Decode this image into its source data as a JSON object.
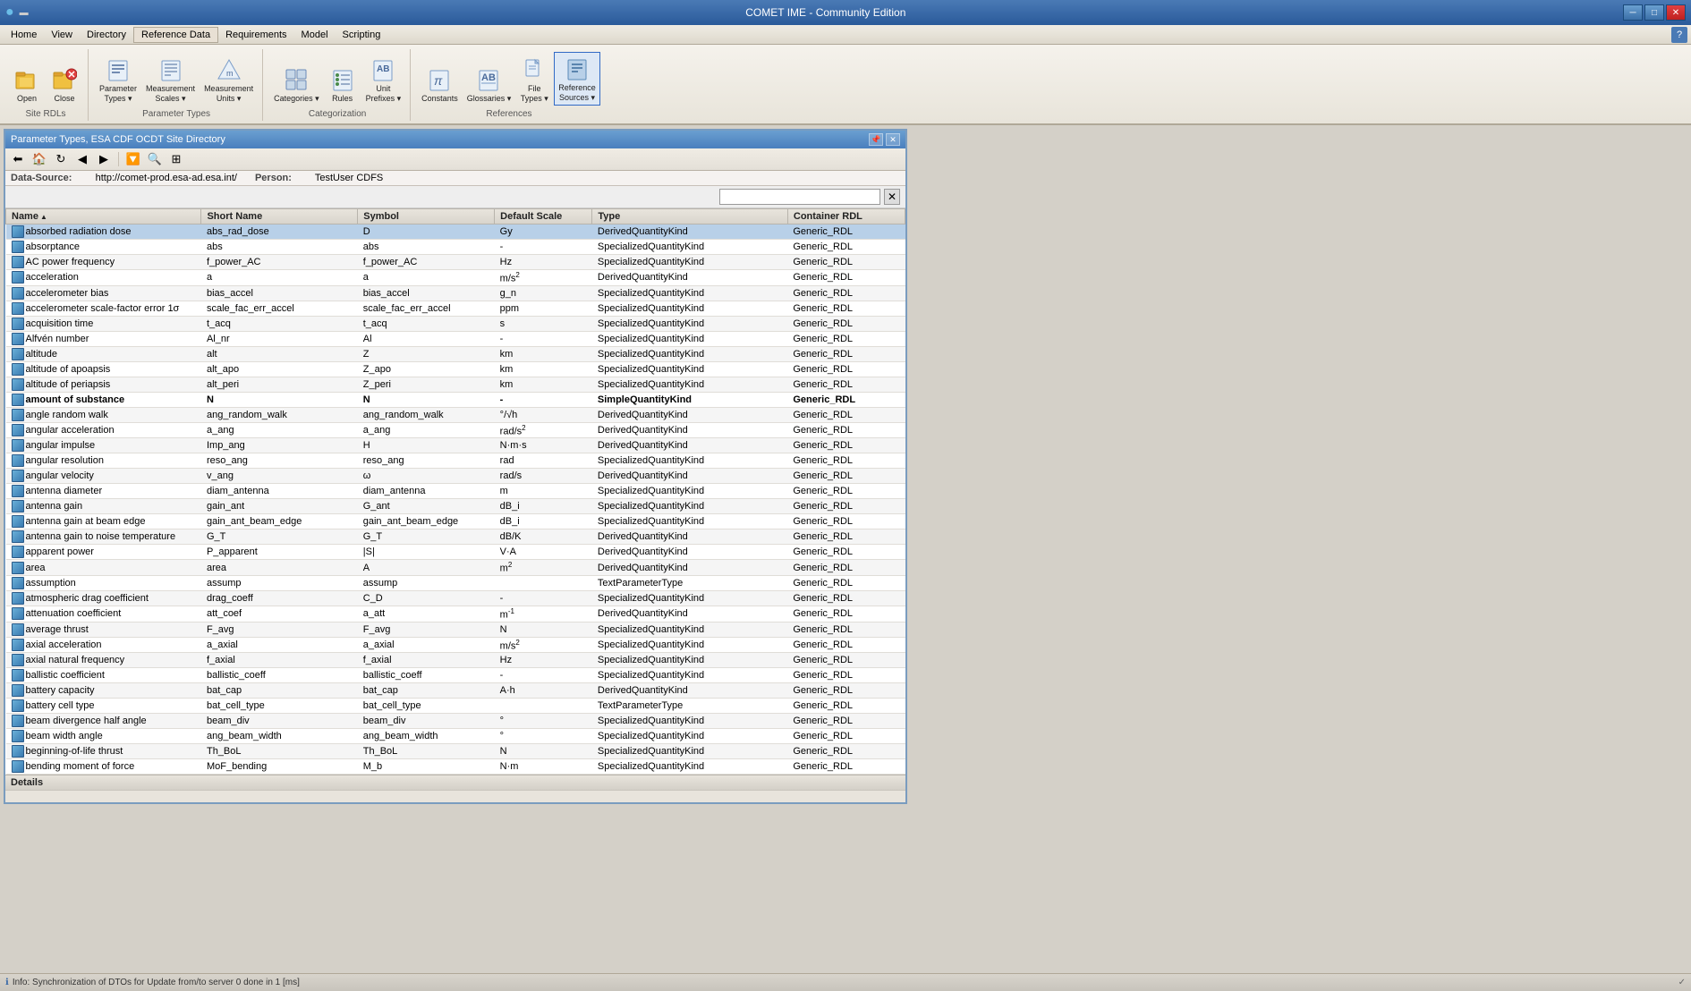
{
  "window": {
    "title": "COMET IME - Community Edition",
    "titlebar_icon": "●"
  },
  "titlebar_buttons": {
    "minimize": "─",
    "maximize": "□",
    "close": "✕"
  },
  "menu": {
    "items": [
      "Home",
      "View",
      "Directory",
      "Reference Data",
      "Requirements",
      "Model",
      "Scripting"
    ]
  },
  "toolbar": {
    "groups": [
      {
        "label": "Site RDLs",
        "buttons": [
          {
            "label": "Open",
            "icon": "📂"
          },
          {
            "label": "Close",
            "icon": "✕"
          }
        ]
      },
      {
        "label": "Parameter Types",
        "buttons": [
          {
            "label": "Parameter\nTypes",
            "icon": "📋",
            "dropdown": true
          },
          {
            "label": "Measurement\nScales",
            "icon": "📏",
            "dropdown": true
          },
          {
            "label": "Measurement\nUnits",
            "icon": "📐",
            "dropdown": true
          }
        ]
      },
      {
        "label": "Categorization",
        "buttons": [
          {
            "label": "Categories",
            "icon": "🗂",
            "dropdown": true
          },
          {
            "label": "Rules",
            "icon": "📜"
          },
          {
            "label": "Unit\nPrefixes",
            "icon": "🔤",
            "dropdown": true
          }
        ]
      },
      {
        "label": "References",
        "buttons": [
          {
            "label": "Constants",
            "icon": "π"
          },
          {
            "label": "Glossaries",
            "icon": "📖",
            "dropdown": true
          },
          {
            "label": "File\nTypes",
            "icon": "📄",
            "dropdown": true
          },
          {
            "label": "Reference\nSources",
            "icon": "🔗",
            "dropdown": true
          }
        ]
      }
    ]
  },
  "doc_panel": {
    "title": "Parameter Types, ESA CDF OCDT Site Directory",
    "datasource": {
      "label": "Data-Source:",
      "value": "http://comet-prod.esa-ad.esa.int/"
    },
    "person": {
      "label": "Person:",
      "value": "TestUser CDFS"
    }
  },
  "table": {
    "columns": [
      {
        "id": "name",
        "label": "Name",
        "sortable": true
      },
      {
        "id": "short_name",
        "label": "Short Name",
        "sortable": false
      },
      {
        "id": "symbol",
        "label": "Symbol",
        "sortable": false
      },
      {
        "id": "default_scale",
        "label": "Default Scale",
        "sortable": false
      },
      {
        "id": "type",
        "label": "Type",
        "sortable": false
      },
      {
        "id": "container_rdl",
        "label": "Container RDL",
        "sortable": false
      }
    ],
    "rows": [
      {
        "name": "absorbed radiation dose",
        "short_name": "abs_rad_dose",
        "symbol": "D",
        "default_scale": "Gy",
        "type": "DerivedQuantityKind",
        "container_rdl": "Generic_RDL",
        "selected": true,
        "bold": false
      },
      {
        "name": "absorptance",
        "short_name": "abs",
        "symbol": "abs",
        "default_scale": "-",
        "type": "SpecializedQuantityKind",
        "container_rdl": "Generic_RDL",
        "selected": false,
        "bold": false
      },
      {
        "name": "AC power frequency",
        "short_name": "f_power_AC",
        "symbol": "f_power_AC",
        "default_scale": "Hz",
        "type": "SpecializedQuantityKind",
        "container_rdl": "Generic_RDL",
        "selected": false,
        "bold": false
      },
      {
        "name": "acceleration",
        "short_name": "a",
        "symbol": "a",
        "default_scale": "m/s²",
        "type": "DerivedQuantityKind",
        "container_rdl": "Generic_RDL",
        "selected": false,
        "bold": false
      },
      {
        "name": "accelerometer bias",
        "short_name": "bias_accel",
        "symbol": "bias_accel",
        "default_scale": "g_n",
        "type": "SpecializedQuantityKind",
        "container_rdl": "Generic_RDL",
        "selected": false,
        "bold": false
      },
      {
        "name": "accelerometer scale-factor error 1σ",
        "short_name": "scale_fac_err_accel",
        "symbol": "scale_fac_err_accel",
        "default_scale": "ppm",
        "type": "SpecializedQuantityKind",
        "container_rdl": "Generic_RDL",
        "selected": false,
        "bold": false
      },
      {
        "name": "acquisition time",
        "short_name": "t_acq",
        "symbol": "t_acq",
        "default_scale": "s",
        "type": "SpecializedQuantityKind",
        "container_rdl": "Generic_RDL",
        "selected": false,
        "bold": false
      },
      {
        "name": "Alfvén number",
        "short_name": "Al_nr",
        "symbol": "Al",
        "default_scale": "-",
        "type": "SpecializedQuantityKind",
        "container_rdl": "Generic_RDL",
        "selected": false,
        "bold": false
      },
      {
        "name": "altitude",
        "short_name": "alt",
        "symbol": "Z",
        "default_scale": "km",
        "type": "SpecializedQuantityKind",
        "container_rdl": "Generic_RDL",
        "selected": false,
        "bold": false
      },
      {
        "name": "altitude of apoapsis",
        "short_name": "alt_apo",
        "symbol": "Z_apo",
        "default_scale": "km",
        "type": "SpecializedQuantityKind",
        "container_rdl": "Generic_RDL",
        "selected": false,
        "bold": false
      },
      {
        "name": "altitude of periapsis",
        "short_name": "alt_peri",
        "symbol": "Z_peri",
        "default_scale": "km",
        "type": "SpecializedQuantityKind",
        "container_rdl": "Generic_RDL",
        "selected": false,
        "bold": false
      },
      {
        "name": "amount of substance",
        "short_name": "N",
        "symbol": "N",
        "default_scale": "-",
        "type": "SimpleQuantityKind",
        "container_rdl": "Generic_RDL",
        "selected": false,
        "bold": true
      },
      {
        "name": "angle random walk",
        "short_name": "ang_random_walk",
        "symbol": "ang_random_walk",
        "default_scale": "°/√h",
        "type": "DerivedQuantityKind",
        "container_rdl": "Generic_RDL",
        "selected": false,
        "bold": false
      },
      {
        "name": "angular acceleration",
        "short_name": "a_ang",
        "symbol": "a_ang",
        "default_scale": "rad/s²",
        "type": "DerivedQuantityKind",
        "container_rdl": "Generic_RDL",
        "selected": false,
        "bold": false
      },
      {
        "name": "angular impulse",
        "short_name": "Imp_ang",
        "symbol": "H",
        "default_scale": "N·m·s",
        "type": "DerivedQuantityKind",
        "container_rdl": "Generic_RDL",
        "selected": false,
        "bold": false
      },
      {
        "name": "angular resolution",
        "short_name": "reso_ang",
        "symbol": "reso_ang",
        "default_scale": "rad",
        "type": "SpecializedQuantityKind",
        "container_rdl": "Generic_RDL",
        "selected": false,
        "bold": false
      },
      {
        "name": "angular velocity",
        "short_name": "v_ang",
        "symbol": "ω",
        "default_scale": "rad/s",
        "type": "DerivedQuantityKind",
        "container_rdl": "Generic_RDL",
        "selected": false,
        "bold": false
      },
      {
        "name": "antenna diameter",
        "short_name": "diam_antenna",
        "symbol": "diam_antenna",
        "default_scale": "m",
        "type": "SpecializedQuantityKind",
        "container_rdl": "Generic_RDL",
        "selected": false,
        "bold": false
      },
      {
        "name": "antenna gain",
        "short_name": "gain_ant",
        "symbol": "G_ant",
        "default_scale": "dB_i",
        "type": "SpecializedQuantityKind",
        "container_rdl": "Generic_RDL",
        "selected": false,
        "bold": false
      },
      {
        "name": "antenna gain at beam edge",
        "short_name": "gain_ant_beam_edge",
        "symbol": "gain_ant_beam_edge",
        "default_scale": "dB_i",
        "type": "SpecializedQuantityKind",
        "container_rdl": "Generic_RDL",
        "selected": false,
        "bold": false
      },
      {
        "name": "antenna gain to noise temperature",
        "short_name": "G_T",
        "symbol": "G_T",
        "default_scale": "dB/K",
        "type": "DerivedQuantityKind",
        "container_rdl": "Generic_RDL",
        "selected": false,
        "bold": false
      },
      {
        "name": "apparent power",
        "short_name": "P_apparent",
        "symbol": "|S|",
        "default_scale": "V·A",
        "type": "DerivedQuantityKind",
        "container_rdl": "Generic_RDL",
        "selected": false,
        "bold": false
      },
      {
        "name": "area",
        "short_name": "area",
        "symbol": "A",
        "default_scale": "m²",
        "type": "DerivedQuantityKind",
        "container_rdl": "Generic_RDL",
        "selected": false,
        "bold": false
      },
      {
        "name": "assumption",
        "short_name": "assump",
        "symbol": "assump",
        "default_scale": "",
        "type": "TextParameterType",
        "container_rdl": "Generic_RDL",
        "selected": false,
        "bold": false
      },
      {
        "name": "atmospheric drag coefficient",
        "short_name": "drag_coeff",
        "symbol": "C_D",
        "default_scale": "-",
        "type": "SpecializedQuantityKind",
        "container_rdl": "Generic_RDL",
        "selected": false,
        "bold": false
      },
      {
        "name": "attenuation coefficient",
        "short_name": "att_coef",
        "symbol": "a_att",
        "default_scale": "m⁻¹",
        "type": "DerivedQuantityKind",
        "container_rdl": "Generic_RDL",
        "selected": false,
        "bold": false
      },
      {
        "name": "average thrust",
        "short_name": "F_avg",
        "symbol": "F_avg",
        "default_scale": "N",
        "type": "SpecializedQuantityKind",
        "container_rdl": "Generic_RDL",
        "selected": false,
        "bold": false
      },
      {
        "name": "axial acceleration",
        "short_name": "a_axial",
        "symbol": "a_axial",
        "default_scale": "m/s²",
        "type": "SpecializedQuantityKind",
        "container_rdl": "Generic_RDL",
        "selected": false,
        "bold": false
      },
      {
        "name": "axial natural frequency",
        "short_name": "f_axial",
        "symbol": "f_axial",
        "default_scale": "Hz",
        "type": "SpecializedQuantityKind",
        "container_rdl": "Generic_RDL",
        "selected": false,
        "bold": false
      },
      {
        "name": "ballistic coefficient",
        "short_name": "ballistic_coeff",
        "symbol": "ballistic_coeff",
        "default_scale": "-",
        "type": "SpecializedQuantityKind",
        "container_rdl": "Generic_RDL",
        "selected": false,
        "bold": false
      },
      {
        "name": "battery capacity",
        "short_name": "bat_cap",
        "symbol": "bat_cap",
        "default_scale": "A·h",
        "type": "DerivedQuantityKind",
        "container_rdl": "Generic_RDL",
        "selected": false,
        "bold": false
      },
      {
        "name": "battery cell type",
        "short_name": "bat_cell_type",
        "symbol": "bat_cell_type",
        "default_scale": "",
        "type": "TextParameterType",
        "container_rdl": "Generic_RDL",
        "selected": false,
        "bold": false
      },
      {
        "name": "beam divergence half angle",
        "short_name": "beam_div",
        "symbol": "beam_div",
        "default_scale": "°",
        "type": "SpecializedQuantityKind",
        "container_rdl": "Generic_RDL",
        "selected": false,
        "bold": false
      },
      {
        "name": "beam width angle",
        "short_name": "ang_beam_width",
        "symbol": "ang_beam_width",
        "default_scale": "°",
        "type": "SpecializedQuantityKind",
        "container_rdl": "Generic_RDL",
        "selected": false,
        "bold": false
      },
      {
        "name": "beginning-of-life thrust",
        "short_name": "Th_BoL",
        "symbol": "Th_BoL",
        "default_scale": "N",
        "type": "SpecializedQuantityKind",
        "container_rdl": "Generic_RDL",
        "selected": false,
        "bold": false
      },
      {
        "name": "bending moment of force",
        "short_name": "MoF_bending",
        "symbol": "M_b",
        "default_scale": "N·m",
        "type": "SpecializedQuantityKind",
        "container_rdl": "Generic_RDL",
        "selected": false,
        "bold": false
      }
    ]
  },
  "details_label": "Details",
  "status": {
    "text": "Info:  Synchronization of DTOs for Update from/to server 0 done in 1 [ms]",
    "icon": "ℹ"
  },
  "search_placeholder": "",
  "help_icon": "?"
}
